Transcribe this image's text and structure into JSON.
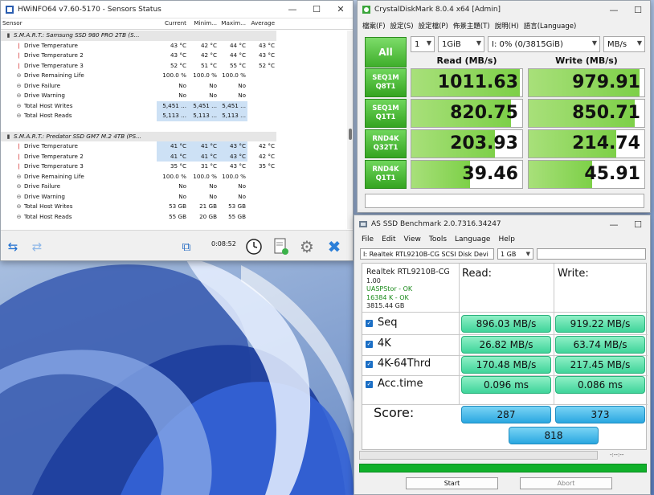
{
  "hwinfo": {
    "title": "HWiNFO64 v7.60-5170 - Sensors Status",
    "headers": [
      "Sensor",
      "Current",
      "Minim...",
      "Maxim...",
      "Average"
    ],
    "rows": [
      {
        "type": "group",
        "icon": "drive-icon",
        "label": "S.M.A.R.T.: Samsung SSD 980 PRO 2TB (S...",
        "v": [
          "",
          "",
          "",
          ""
        ]
      },
      {
        "type": "temp",
        "label": "Drive Temperature",
        "v": [
          "43 °C",
          "42 °C",
          "44 °C",
          "43 °C"
        ]
      },
      {
        "type": "temp",
        "label": "Drive Temperature 2",
        "v": [
          "43 °C",
          "42 °C",
          "44 °C",
          "43 °C"
        ]
      },
      {
        "type": "temp",
        "label": "Drive Temperature 3",
        "v": [
          "52 °C",
          "51 °C",
          "55 °C",
          "52 °C"
        ]
      },
      {
        "type": "info",
        "label": "Drive Remaining Life",
        "v": [
          "100.0 %",
          "100.0 %",
          "100.0 %",
          ""
        ]
      },
      {
        "type": "info",
        "label": "Drive Failure",
        "v": [
          "No",
          "No",
          "No",
          ""
        ]
      },
      {
        "type": "info",
        "label": "Drive Warning",
        "v": [
          "No",
          "No",
          "No",
          ""
        ]
      },
      {
        "type": "info",
        "label": "Total Host Writes",
        "v": [
          "5,451 ...",
          "5,451 ...",
          "5,451 ...",
          ""
        ],
        "hl": true
      },
      {
        "type": "info",
        "label": "Total Host Reads",
        "v": [
          "5,113 ...",
          "5,113 ...",
          "5,113 ...",
          ""
        ],
        "hl": true
      },
      {
        "type": "gap",
        "label": "",
        "v": [
          "",
          "",
          "",
          ""
        ]
      },
      {
        "type": "group",
        "icon": "drive-icon",
        "label": "S.M.A.R.T.: Predator SSD GM7 M.2 4TB (PS...",
        "v": [
          "",
          "",
          "",
          ""
        ]
      },
      {
        "type": "temp",
        "label": "Drive Temperature",
        "v": [
          "41 °C",
          "41 °C",
          "43 °C",
          "42 °C"
        ],
        "hl": true
      },
      {
        "type": "temp",
        "label": "Drive Temperature 2",
        "v": [
          "41 °C",
          "41 °C",
          "43 °C",
          "42 °C"
        ],
        "hl": true
      },
      {
        "type": "temp",
        "label": "Drive Temperature 3",
        "v": [
          "35 °C",
          "31 °C",
          "43 °C",
          "35 °C"
        ]
      },
      {
        "type": "info",
        "label": "Drive Remaining Life",
        "v": [
          "100.0 %",
          "100.0 %",
          "100.0 %",
          ""
        ]
      },
      {
        "type": "info",
        "label": "Drive Failure",
        "v": [
          "No",
          "No",
          "No",
          ""
        ]
      },
      {
        "type": "info",
        "label": "Drive Warning",
        "v": [
          "No",
          "No",
          "No",
          ""
        ]
      },
      {
        "type": "info",
        "label": "Total Host Writes",
        "v": [
          "53 GB",
          "21 GB",
          "53 GB",
          ""
        ]
      },
      {
        "type": "info",
        "label": "Total Host Reads",
        "v": [
          "55 GB",
          "20 GB",
          "55 GB",
          ""
        ]
      }
    ],
    "timer": "0:08:52"
  },
  "cdm": {
    "title": "CrystalDiskMark 8.0.4 x64 [Admin]",
    "menu": [
      "檔案(F)",
      "設定(S)",
      "設定檔(P)",
      "佈景主題(T)",
      "說明(H)",
      "語言(Language)"
    ],
    "all_label": "All",
    "count": "1",
    "size": "1GiB",
    "drive": "I: 0% (0/3815GiB)",
    "unit": "MB/s",
    "read_header": "Read (MB/s)",
    "write_header": "Write (MB/s)",
    "tests": [
      {
        "l1": "SEQ1M",
        "l2": "Q8T1",
        "read": "1011.63",
        "write": "979.91",
        "rf": 0.98,
        "wf": 0.96
      },
      {
        "l1": "SEQ1M",
        "l2": "Q1T1",
        "read": "820.75",
        "write": "850.71",
        "rf": 0.9,
        "wf": 0.92
      },
      {
        "l1": "RND4K",
        "l2": "Q32T1",
        "read": "203.93",
        "write": "214.74",
        "rf": 0.75,
        "wf": 0.76
      },
      {
        "l1": "RND4K",
        "l2": "Q1T1",
        "read": "39.46",
        "write": "45.91",
        "rf": 0.53,
        "wf": 0.55
      }
    ]
  },
  "asssd": {
    "title": "AS SSD Benchmark 2.0.7316.34247",
    "menu": [
      "File",
      "Edit",
      "View",
      "Tools",
      "Language",
      "Help"
    ],
    "drive": "I: Realtek RTL9210B-CG SCSI Disk Devi",
    "size": "1 GB",
    "info": [
      "Realtek RTL9210B-CG",
      "1.00",
      "UASPStor - OK",
      "16384 K - OK",
      "3815.44 GB"
    ],
    "read_header": "Read:",
    "write_header": "Write:",
    "rows": [
      {
        "label": "Seq",
        "read": "896.03 MB/s",
        "write": "919.22 MB/s"
      },
      {
        "label": "4K",
        "read": "26.82 MB/s",
        "write": "63.74 MB/s"
      },
      {
        "label": "4K-64Thrd",
        "read": "170.48 MB/s",
        "write": "217.45 MB/s"
      },
      {
        "label": "Acc.time",
        "read": "0.096 ms",
        "write": "0.086 ms"
      }
    ],
    "score_label": "Score:",
    "score_read": "287",
    "score_write": "373",
    "score_total": "818",
    "time": "-:--:--",
    "start_label": "Start",
    "abort_label": "Abort"
  }
}
